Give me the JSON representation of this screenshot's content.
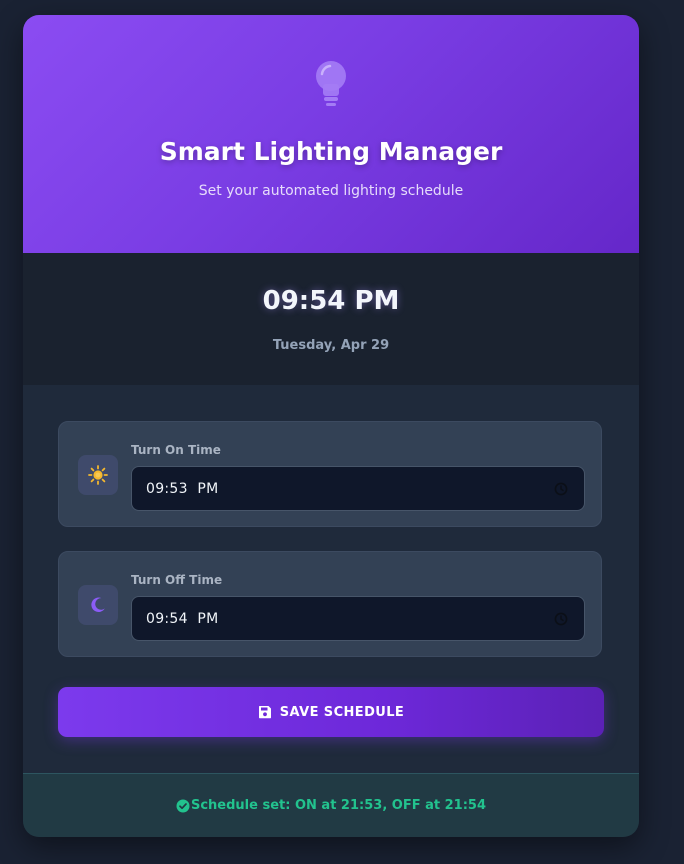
{
  "header": {
    "title": "Smart Lighting Manager",
    "subtitle": "Set your automated lighting schedule",
    "icon": "lightbulb-icon"
  },
  "clock": {
    "time": "09:54 PM",
    "date": "Tuesday, Apr 29"
  },
  "schedule": {
    "on": {
      "label": "Turn On Time",
      "value": "09:53  PM",
      "icon": "sun-icon"
    },
    "off": {
      "label": "Turn Off Time",
      "value": "09:54  PM",
      "icon": "moon-icon"
    }
  },
  "actions": {
    "save_label": "SAVE SCHEDULE",
    "save_icon": "save-icon"
  },
  "status": {
    "text": "Schedule set: ON at 21:53, OFF at 21:54",
    "icon": "check-circle-icon"
  },
  "colors": {
    "accent": "#7c3aed",
    "success": "#22c38e",
    "sun": "#f5b82e",
    "moon": "#8b5cf6"
  }
}
